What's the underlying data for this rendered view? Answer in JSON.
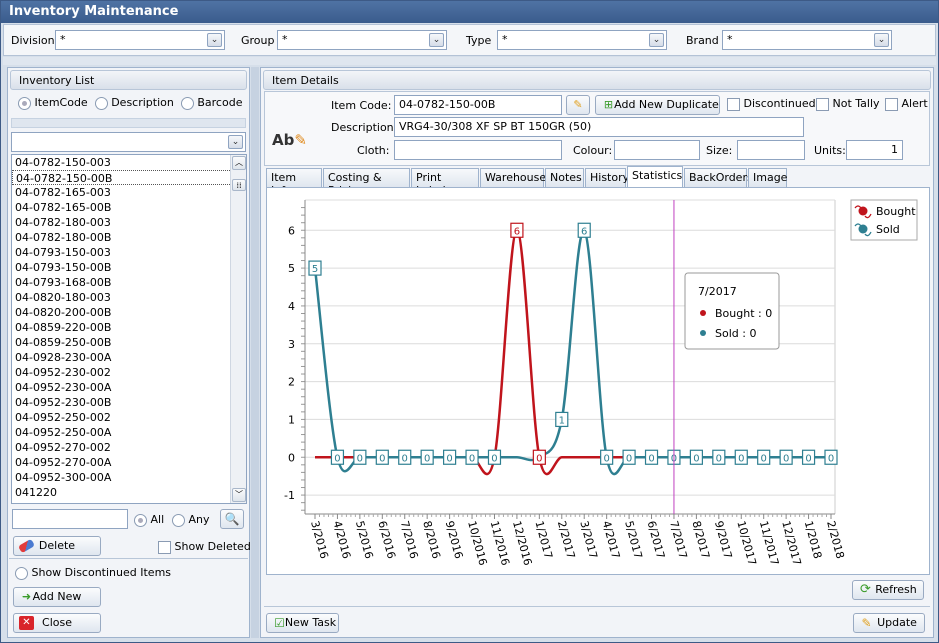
{
  "window": {
    "title": "Inventory Maintenance"
  },
  "filters": [
    {
      "label": "Division",
      "value": "*"
    },
    {
      "label": "Group",
      "value": "*"
    },
    {
      "label": "Type",
      "value": "*"
    },
    {
      "label": "Brand",
      "value": "*"
    }
  ],
  "inventory_list": {
    "title": "Inventory List",
    "search_modes": [
      {
        "label": "ItemCode",
        "selected": true
      },
      {
        "label": "Description",
        "selected": false
      },
      {
        "label": "Barcode",
        "selected": false
      }
    ],
    "combo_value": "",
    "items": [
      "04-0782-150-003",
      "04-0782-150-00B",
      "04-0782-165-003",
      "04-0782-165-00B",
      "04-0782-180-003",
      "04-0782-180-00B",
      "04-0793-150-003",
      "04-0793-150-00B",
      "04-0793-168-00B",
      "04-0820-180-003",
      "04-0820-200-00B",
      "04-0859-220-00B",
      "04-0859-250-00B",
      "04-0928-230-00A",
      "04-0952-230-002",
      "04-0952-230-00A",
      "04-0952-230-00B",
      "04-0952-250-002",
      "04-0952-250-00A",
      "04-0952-270-002",
      "04-0952-270-00A",
      "04-0952-300-00A",
      "041220"
    ],
    "selected_index": 1,
    "search_value": "",
    "match_all_label": "All",
    "match_any_label": "Any",
    "delete_label": "Delete",
    "show_deleted_label": "Show Deleted",
    "show_discontinued_label": "Show Discontinued Items",
    "add_new_label": "Add New",
    "close_label": "Close"
  },
  "item_details": {
    "title": "Item Details",
    "item_code_label": "Item Code:",
    "item_code": "04-0782-150-00B",
    "add_duplicate_label": "Add New Duplicate",
    "discontinued_label": "Discontinued",
    "not_tally_label": "Not Tally",
    "alert_label": "Alert",
    "description_label": "Description:",
    "description": "VRG4-30/308 XF SP BT 150GR (50)",
    "cloth_label": "Cloth:",
    "cloth": "",
    "colour_label": "Colour:",
    "colour": "",
    "size_label": "Size:",
    "size": "",
    "units_label": "Units:",
    "units": "1",
    "tabs": [
      "Item Info",
      "Costing & Pricing",
      "Print Labels",
      "Warehouse",
      "Notes",
      "History",
      "Statistics",
      "BackOrders",
      "Image"
    ],
    "active_tab": "Statistics",
    "refresh_label": "Refresh",
    "new_task_label": "New Task",
    "update_label": "Update"
  },
  "colors": {
    "bought": "#c0141c",
    "sold": "#2e7f91",
    "crosshair": "#c040c0"
  },
  "chart_data": {
    "type": "line",
    "title": "",
    "xlabel": "",
    "ylabel": "",
    "x": [
      "3/2016",
      "4/2016",
      "5/2016",
      "6/2016",
      "7/2016",
      "8/2016",
      "9/2016",
      "10/2016",
      "11/2016",
      "12/2016",
      "1/2017",
      "2/2017",
      "3/2017",
      "4/2017",
      "5/2017",
      "6/2017",
      "7/2017",
      "8/2017",
      "9/2017",
      "10/2017",
      "11/2017",
      "12/2017",
      "1/2018",
      "2/2018"
    ],
    "series": [
      {
        "name": "Bought",
        "values": [
          0,
          0,
          0,
          0,
          0,
          0,
          0,
          0,
          0,
          6,
          0,
          0,
          0,
          0,
          0,
          0,
          0,
          0,
          0,
          0,
          0,
          0,
          0,
          0
        ]
      },
      {
        "name": "Sold",
        "values": [
          5,
          0,
          0,
          0,
          0,
          0,
          0,
          0,
          0,
          0,
          0,
          1,
          6,
          0,
          0,
          0,
          0,
          0,
          0,
          0,
          0,
          0,
          0,
          0
        ]
      }
    ],
    "y_ticks": [
      "-1",
      "0",
      "1",
      "2",
      "3",
      "4",
      "5",
      "6"
    ],
    "ylim": [
      -1.5,
      6.8
    ],
    "grid": true,
    "legend": "top-right",
    "crosshair_x": "7/2017",
    "tooltip": {
      "title": "7/2017",
      "lines": [
        "Bought : 0",
        "Sold : 0"
      ]
    }
  }
}
